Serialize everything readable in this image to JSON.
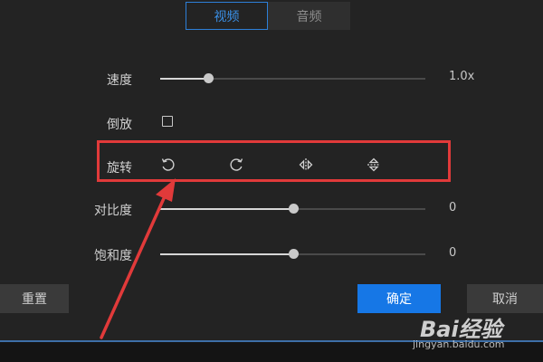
{
  "tabs": [
    {
      "label": "视频",
      "active": true
    },
    {
      "label": "音频",
      "active": false
    }
  ],
  "controls": {
    "speed": {
      "label": "速度",
      "value_text": "1.0x",
      "level": 0.18
    },
    "reverse": {
      "label": "倒放",
      "checked": false
    },
    "rotate": {
      "label": "旋转",
      "icons": [
        "rotate-counterclockwise-icon",
        "rotate-clockwise-icon",
        "flip-horizontal-icon",
        "flip-vertical-icon"
      ]
    },
    "contrast": {
      "label": "对比度",
      "value_text": "0",
      "level": 0.5
    },
    "saturation": {
      "label": "饱和度",
      "value_text": "0",
      "level": 0.5
    }
  },
  "buttons": {
    "reset": "重置",
    "confirm": "确定",
    "cancel": "取消"
  },
  "watermark": {
    "logo": "Bai经验",
    "url": "jingyan.baidu.com"
  },
  "colors": {
    "background": "#232323",
    "accent": "#1677e6",
    "highlight": "#e13a3a"
  }
}
